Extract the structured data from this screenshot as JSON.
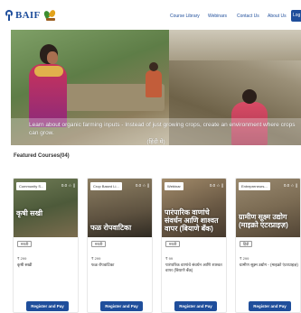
{
  "header": {
    "logo_text": "BAIF",
    "nav": [
      "Course Library",
      "Webinars",
      "Contact Us",
      "About Us"
    ],
    "login_label": "Log"
  },
  "banner": {
    "caption_line1": "Learn about organic farming inputs - Instead of just growing crops, create an environment where crops can grow.",
    "caption_line2": "(हिंदी मे)"
  },
  "featured": {
    "title": "Featured Courses(04)"
  },
  "courses": [
    {
      "tag": "Community S...",
      "rating": "0.0 ☆ ||",
      "overlay": "कृषी सखी",
      "lang": "मराठी",
      "price": "₹ 299",
      "name": "कृषी सखी",
      "button": "Register and Pay"
    },
    {
      "tag": "Crop Based Li...",
      "rating": "0.0 ☆ ||",
      "overlay": "फळ रोपवाटिका",
      "lang": "मराठी",
      "price": "₹ 299",
      "name": "फळ रोपवाटिका",
      "button": "Register and Pay"
    },
    {
      "tag": "Webinar",
      "rating": "0.0 ☆ ||",
      "overlay": "पारंपारिक वाणांचे संवर्धन आणि शाश्वत वापर (बियाणे बँक)",
      "lang": "मराठी",
      "price": "₹ 99",
      "name": "पारंपारिक वाणांचे संवर्धन आणि शाश्वत वापर (बियाणे बँक)",
      "button": "Register and Pay"
    },
    {
      "tag": "Entrepreneurs...",
      "rating": "0.0 ☆ ||",
      "overlay": "ग्रामीण सूक्ष्म उद्योग (माइक्रो एंटरप्राइज़)",
      "lang": "हिंदी",
      "price": "₹ 299",
      "name": "ग्रामीण सूक्ष्म उद्योग - (माइक्रो एंटरप्राइज़)",
      "button": "Register and Pay"
    }
  ],
  "colors": {
    "brand": "#1f4e9b",
    "button": "#1f4e9b"
  }
}
